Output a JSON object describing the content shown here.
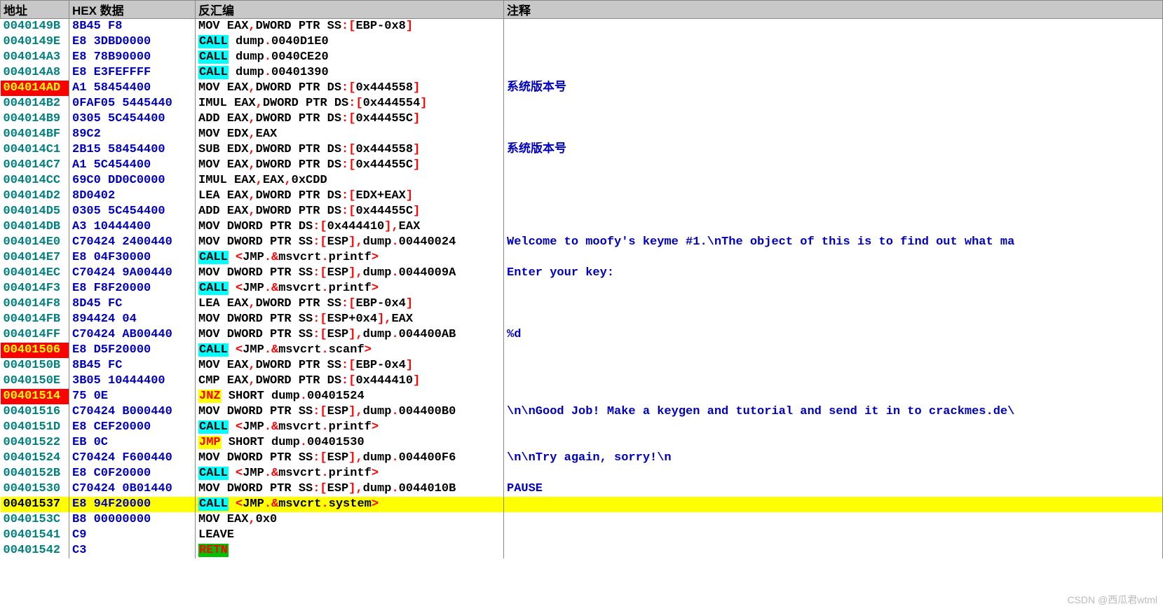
{
  "headers": {
    "addr": "地址",
    "hex": "HEX 数据",
    "dis": "反汇编",
    "cmt": "注释"
  },
  "watermark": "CSDN @西瓜君wtml",
  "rows": [
    {
      "addr": "0040149B",
      "hex": "8B45 F8",
      "dis": [
        {
          "t": "MOV EAX"
        },
        {
          "p": ","
        },
        {
          "t": "DWORD PTR SS"
        },
        {
          "p": ":["
        },
        {
          "t": "EBP-0x8"
        },
        {
          "p": "]"
        }
      ],
      "cmt": ""
    },
    {
      "addr": "0040149E",
      "hex": "E8 3DBD0000",
      "dis": [
        {
          "op": "CALL",
          "c": "op-call"
        },
        {
          "t": " dump"
        },
        {
          "p": "."
        },
        {
          "t": "0040D1E0"
        }
      ],
      "cmt": ""
    },
    {
      "addr": "004014A3",
      "hex": "E8 78B90000",
      "dis": [
        {
          "op": "CALL",
          "c": "op-call"
        },
        {
          "t": " dump"
        },
        {
          "p": "."
        },
        {
          "t": "0040CE20"
        }
      ],
      "cmt": ""
    },
    {
      "addr": "004014A8",
      "hex": "E8 E3FEFFFF",
      "dis": [
        {
          "op": "CALL",
          "c": "op-call"
        },
        {
          "t": " dump"
        },
        {
          "p": "."
        },
        {
          "t": "00401390"
        }
      ],
      "cmt": ""
    },
    {
      "addr": "004014AD",
      "addrClass": "bp-red",
      "hex": "A1 58454400",
      "dis": [
        {
          "t": "MOV EAX"
        },
        {
          "p": ","
        },
        {
          "t": "DWORD PTR DS"
        },
        {
          "p": ":["
        },
        {
          "t": "0x444558"
        },
        {
          "p": "]"
        }
      ],
      "cmt": "系统版本号"
    },
    {
      "addr": "004014B2",
      "hex": "0FAF05 5445440",
      "dis": [
        {
          "t": "IMUL EAX"
        },
        {
          "p": ","
        },
        {
          "t": "DWORD PTR DS"
        },
        {
          "p": ":["
        },
        {
          "t": "0x444554"
        },
        {
          "p": "]"
        }
      ],
      "cmt": ""
    },
    {
      "addr": "004014B9",
      "hex": "0305 5C454400",
      "dis": [
        {
          "t": "ADD EAX"
        },
        {
          "p": ","
        },
        {
          "t": "DWORD PTR DS"
        },
        {
          "p": ":["
        },
        {
          "t": "0x44455C"
        },
        {
          "p": "]"
        }
      ],
      "cmt": ""
    },
    {
      "addr": "004014BF",
      "hex": "89C2",
      "dis": [
        {
          "t": "MOV EDX"
        },
        {
          "p": ","
        },
        {
          "t": "EAX"
        }
      ],
      "cmt": ""
    },
    {
      "addr": "004014C1",
      "hex": "2B15 58454400",
      "dis": [
        {
          "t": "SUB EDX"
        },
        {
          "p": ","
        },
        {
          "t": "DWORD PTR DS"
        },
        {
          "p": ":["
        },
        {
          "t": "0x444558"
        },
        {
          "p": "]"
        }
      ],
      "cmt": "系统版本号"
    },
    {
      "addr": "004014C7",
      "hex": "A1 5C454400",
      "dis": [
        {
          "t": "MOV EAX"
        },
        {
          "p": ","
        },
        {
          "t": "DWORD PTR DS"
        },
        {
          "p": ":["
        },
        {
          "t": "0x44455C"
        },
        {
          "p": "]"
        }
      ],
      "cmt": ""
    },
    {
      "addr": "004014CC",
      "hex": "69C0 DD0C0000",
      "dis": [
        {
          "t": "IMUL EAX"
        },
        {
          "p": ","
        },
        {
          "t": "EAX"
        },
        {
          "p": ","
        },
        {
          "t": "0xCDD"
        }
      ],
      "cmt": ""
    },
    {
      "addr": "004014D2",
      "hex": "8D0402",
      "dis": [
        {
          "t": "LEA EAX"
        },
        {
          "p": ","
        },
        {
          "t": "DWORD PTR DS"
        },
        {
          "p": ":["
        },
        {
          "t": "EDX+EAX"
        },
        {
          "p": "]"
        }
      ],
      "cmt": ""
    },
    {
      "addr": "004014D5",
      "hex": "0305 5C454400",
      "dis": [
        {
          "t": "ADD EAX"
        },
        {
          "p": ","
        },
        {
          "t": "DWORD PTR DS"
        },
        {
          "p": ":["
        },
        {
          "t": "0x44455C"
        },
        {
          "p": "]"
        }
      ],
      "cmt": ""
    },
    {
      "addr": "004014DB",
      "hex": "A3 10444400",
      "dis": [
        {
          "t": "MOV DWORD PTR DS"
        },
        {
          "p": ":["
        },
        {
          "t": "0x444410"
        },
        {
          "p": "],"
        },
        {
          "t": "EAX"
        }
      ],
      "cmt": ""
    },
    {
      "addr": "004014E0",
      "hex": "C70424 2400440",
      "dis": [
        {
          "t": "MOV DWORD PTR SS"
        },
        {
          "p": ":["
        },
        {
          "t": "ESP"
        },
        {
          "p": "],"
        },
        {
          "t": "dump"
        },
        {
          "p": "."
        },
        {
          "t": "00440024"
        }
      ],
      "cmt": "Welcome to moofy's keyme #1.\\nThe object of this is to find out what ma"
    },
    {
      "addr": "004014E7",
      "hex": "E8 04F30000",
      "dis": [
        {
          "op": "CALL",
          "c": "op-call"
        },
        {
          "t": " "
        },
        {
          "p": "<"
        },
        {
          "t": "JMP"
        },
        {
          "p": ".&"
        },
        {
          "t": "msvcrt"
        },
        {
          "p": "."
        },
        {
          "t": "printf"
        },
        {
          "p": ">"
        }
      ],
      "cmt": ""
    },
    {
      "addr": "004014EC",
      "hex": "C70424 9A00440",
      "dis": [
        {
          "t": "MOV DWORD PTR SS"
        },
        {
          "p": ":["
        },
        {
          "t": "ESP"
        },
        {
          "p": "],"
        },
        {
          "t": "dump"
        },
        {
          "p": "."
        },
        {
          "t": "0044009A"
        }
      ],
      "cmt": "Enter your key:"
    },
    {
      "addr": "004014F3",
      "hex": "E8 F8F20000",
      "dis": [
        {
          "op": "CALL",
          "c": "op-call"
        },
        {
          "t": " "
        },
        {
          "p": "<"
        },
        {
          "t": "JMP"
        },
        {
          "p": ".&"
        },
        {
          "t": "msvcrt"
        },
        {
          "p": "."
        },
        {
          "t": "printf"
        },
        {
          "p": ">"
        }
      ],
      "cmt": ""
    },
    {
      "addr": "004014F8",
      "hex": "8D45 FC",
      "dis": [
        {
          "t": "LEA EAX"
        },
        {
          "p": ","
        },
        {
          "t": "DWORD PTR SS"
        },
        {
          "p": ":["
        },
        {
          "t": "EBP-0x4"
        },
        {
          "p": "]"
        }
      ],
      "cmt": ""
    },
    {
      "addr": "004014FB",
      "hex": "894424 04",
      "dis": [
        {
          "t": "MOV DWORD PTR SS"
        },
        {
          "p": ":["
        },
        {
          "t": "ESP+0x4"
        },
        {
          "p": "],"
        },
        {
          "t": "EAX"
        }
      ],
      "cmt": ""
    },
    {
      "addr": "004014FF",
      "hex": "C70424 AB00440",
      "dis": [
        {
          "t": "MOV DWORD PTR SS"
        },
        {
          "p": ":["
        },
        {
          "t": "ESP"
        },
        {
          "p": "],"
        },
        {
          "t": "dump"
        },
        {
          "p": "."
        },
        {
          "t": "004400AB"
        }
      ],
      "cmt": "%d"
    },
    {
      "addr": "00401506",
      "addrClass": "bp-red",
      "hex": "E8 D5F20000",
      "dis": [
        {
          "op": "CALL",
          "c": "op-call"
        },
        {
          "t": " "
        },
        {
          "p": "<"
        },
        {
          "t": "JMP"
        },
        {
          "p": ".&"
        },
        {
          "t": "msvcrt"
        },
        {
          "p": "."
        },
        {
          "t": "scanf"
        },
        {
          "p": ">"
        }
      ],
      "cmt": ""
    },
    {
      "addr": "0040150B",
      "hex": "8B45 FC",
      "dis": [
        {
          "t": "MOV EAX"
        },
        {
          "p": ","
        },
        {
          "t": "DWORD PTR SS"
        },
        {
          "p": ":["
        },
        {
          "t": "EBP-0x4"
        },
        {
          "p": "]"
        }
      ],
      "cmt": ""
    },
    {
      "addr": "0040150E",
      "hex": "3B05 10444400",
      "dis": [
        {
          "t": "CMP EAX"
        },
        {
          "p": ","
        },
        {
          "t": "DWORD PTR DS"
        },
        {
          "p": ":["
        },
        {
          "t": "0x444410"
        },
        {
          "p": "]"
        }
      ],
      "cmt": ""
    },
    {
      "addr": "00401514",
      "addrClass": "bp-red",
      "hex": "75 0E",
      "dis": [
        {
          "op": "JNZ",
          "c": "op-jnz"
        },
        {
          "t": " SHORT dump"
        },
        {
          "p": "."
        },
        {
          "t": "00401524"
        }
      ],
      "cmt": "",
      "jmark": "˅"
    },
    {
      "addr": "00401516",
      "hex": "C70424 B000440",
      "dis": [
        {
          "t": "MOV DWORD PTR SS"
        },
        {
          "p": ":["
        },
        {
          "t": "ESP"
        },
        {
          "p": "],"
        },
        {
          "t": "dump"
        },
        {
          "p": "."
        },
        {
          "t": "004400B0"
        }
      ],
      "cmt": "\\n\\nGood Job! Make a keygen and tutorial and send it in to crackmes.de\\"
    },
    {
      "addr": "0040151D",
      "hex": "E8 CEF20000",
      "dis": [
        {
          "op": "CALL",
          "c": "op-call"
        },
        {
          "t": " "
        },
        {
          "p": "<"
        },
        {
          "t": "JMP"
        },
        {
          "p": ".&"
        },
        {
          "t": "msvcrt"
        },
        {
          "p": "."
        },
        {
          "t": "printf"
        },
        {
          "p": ">"
        }
      ],
      "cmt": ""
    },
    {
      "addr": "00401522",
      "hex": "EB 0C",
      "dis": [
        {
          "op": "JMP",
          "c": "op-jmp"
        },
        {
          "t": " SHORT dump"
        },
        {
          "p": "."
        },
        {
          "t": "00401530"
        }
      ],
      "cmt": "",
      "jmark": "˅"
    },
    {
      "addr": "00401524",
      "hex": "C70424 F600440",
      "dis": [
        {
          "t": "MOV DWORD PTR SS"
        },
        {
          "p": ":["
        },
        {
          "t": "ESP"
        },
        {
          "p": "],"
        },
        {
          "t": "dump"
        },
        {
          "p": "."
        },
        {
          "t": "004400F6"
        }
      ],
      "cmt": "\\n\\nTry again, sorry!\\n"
    },
    {
      "addr": "0040152B",
      "hex": "E8 C0F20000",
      "dis": [
        {
          "op": "CALL",
          "c": "op-call"
        },
        {
          "t": " "
        },
        {
          "p": "<"
        },
        {
          "t": "JMP"
        },
        {
          "p": ".&"
        },
        {
          "t": "msvcrt"
        },
        {
          "p": "."
        },
        {
          "t": "printf"
        },
        {
          "p": ">"
        }
      ],
      "cmt": ""
    },
    {
      "addr": "00401530",
      "hex": "C70424 0B01440",
      "dis": [
        {
          "t": "MOV DWORD PTR SS"
        },
        {
          "p": ":["
        },
        {
          "t": "ESP"
        },
        {
          "p": "],"
        },
        {
          "t": "dump"
        },
        {
          "p": "."
        },
        {
          "t": "0044010B"
        }
      ],
      "cmt": "PAUSE"
    },
    {
      "addr": "00401537",
      "rowClass": "sel-yellow",
      "hex": "E8 94F20000",
      "dis": [
        {
          "op": "CALL",
          "c": "op-call"
        },
        {
          "t": " "
        },
        {
          "p": "<"
        },
        {
          "t": "JMP"
        },
        {
          "p": ".&"
        },
        {
          "t": "msvcrt"
        },
        {
          "p": "."
        },
        {
          "t": "system"
        },
        {
          "p": ">"
        }
      ],
      "cmt": ""
    },
    {
      "addr": "0040153C",
      "hex": "B8 00000000",
      "dis": [
        {
          "t": "MOV EAX"
        },
        {
          "p": ","
        },
        {
          "t": "0x0"
        }
      ],
      "cmt": ""
    },
    {
      "addr": "00401541",
      "hex": "C9",
      "dis": [
        {
          "t": "LEAVE"
        }
      ],
      "cmt": ""
    },
    {
      "addr": "00401542",
      "hex": "C3",
      "dis": [
        {
          "op": "RETN",
          "c": "op-retn"
        }
      ],
      "cmt": ""
    }
  ]
}
